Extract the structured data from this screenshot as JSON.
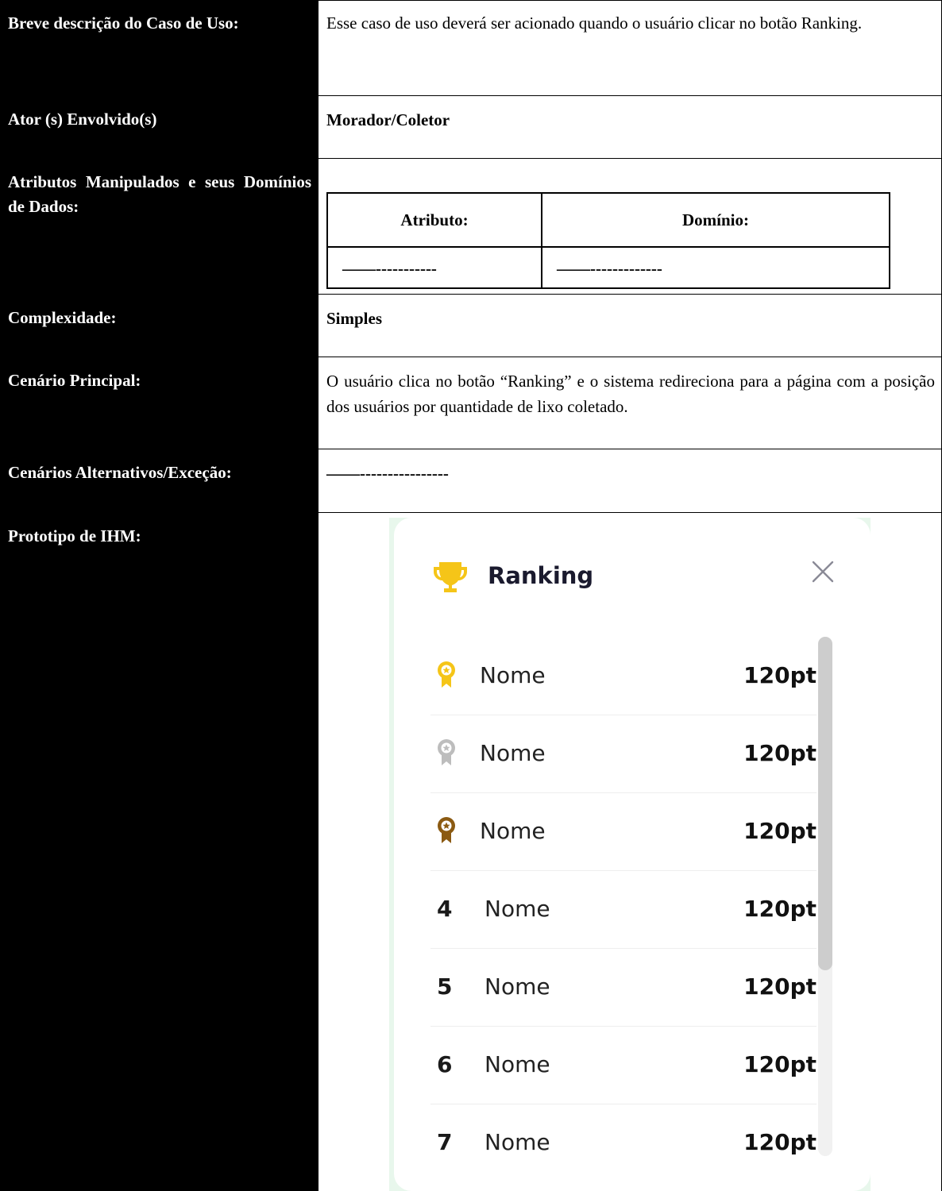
{
  "rows": {
    "descricao": {
      "label": "Breve descrição do Caso de Uso:",
      "value": "Esse caso de uso deverá ser acionado quando o usuário clicar no botão Ranking."
    },
    "ator": {
      "label": "Ator (s) Envolvido(s)",
      "value": "Morador/Coletor"
    },
    "atributos": {
      "label": "Atributos Manipulados e seus Domínios de Dados:",
      "table": {
        "col1_header": "Atributo:",
        "col2_header": "Domínio:",
        "col1_value": "——-----------",
        "col2_value": "——-------------"
      }
    },
    "complexidade": {
      "label": "Complexidade:",
      "value": "Simples"
    },
    "cenario_principal": {
      "label": "Cenário Principal:",
      "value": "O usuário clica no botão “Ranking” e o sistema redireciona para a página com a posição dos usuários por quantidade de lixo coletado."
    },
    "cenarios_alternativos": {
      "label": "Cenários Alternativos/Exceção:",
      "value": "——----------------"
    },
    "prototipo": {
      "label": "Prototipo de IHM:"
    }
  },
  "prototype": {
    "title": "Ranking",
    "trophy_icon": "trophy-icon",
    "close_icon": "close-icon",
    "colors": {
      "gold": "#F5C518",
      "silver": "#BDBDBD",
      "bronze": "#8B5A12",
      "background_tint": "#E8F7EC"
    },
    "items": [
      {
        "rank": "",
        "medal": "gold",
        "name": "Nome",
        "points": "120pt"
      },
      {
        "rank": "",
        "medal": "silver",
        "name": "Nome",
        "points": "120pt"
      },
      {
        "rank": "",
        "medal": "bronze",
        "name": "Nome",
        "points": "120pt"
      },
      {
        "rank": "4",
        "medal": "",
        "name": "Nome",
        "points": "120pt"
      },
      {
        "rank": "5",
        "medal": "",
        "name": "Nome",
        "points": "120pt"
      },
      {
        "rank": "6",
        "medal": "",
        "name": "Nome",
        "points": "120pt"
      },
      {
        "rank": "7",
        "medal": "",
        "name": "Nome",
        "points": "120pt"
      }
    ]
  }
}
